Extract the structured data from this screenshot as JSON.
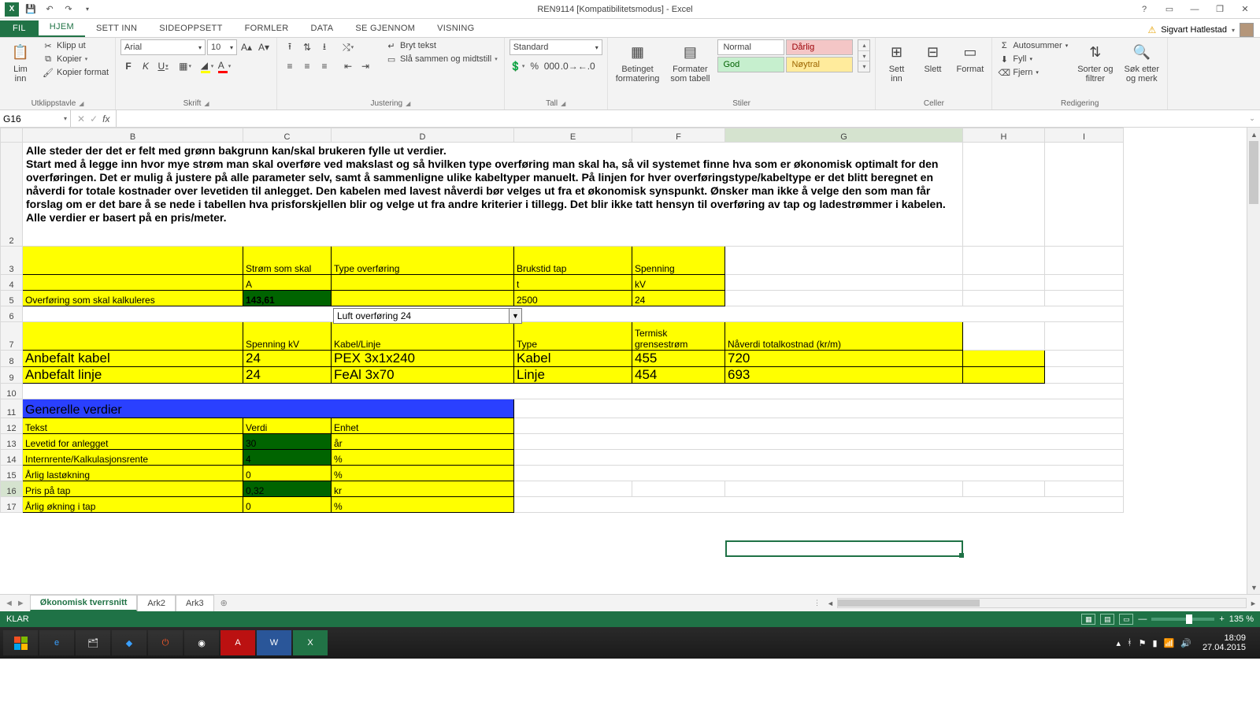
{
  "title": "REN9114  [Kompatibilitetsmodus] - Excel",
  "user_name": "Sigvart Hatlestad",
  "name_box": "G16",
  "formula_bar": "",
  "ribbon": {
    "tabs": {
      "file": "FIL",
      "home": "HJEM",
      "insert": "SETT INN",
      "layout": "SIDEOPPSETT",
      "formulas": "FORMLER",
      "data": "DATA",
      "review": "SE GJENNOM",
      "view": "VISNING"
    },
    "clipboard": {
      "paste": "Lim\ninn",
      "cut": "Klipp ut",
      "copy": "Kopier",
      "painter": "Kopier format",
      "label": "Utklippstavle"
    },
    "font": {
      "name": "Arial",
      "size": "10",
      "label": "Skrift",
      "bold": "F",
      "italic": "K",
      "underline": "U"
    },
    "alignment": {
      "wrap": "Bryt tekst",
      "merge": "Slå sammen og midtstill",
      "label": "Justering"
    },
    "number": {
      "format": "Standard",
      "label": "Tall"
    },
    "styles": {
      "cond": "Betinget\nformatering",
      "table": "Formater\nsom tabell",
      "normal": "Normal",
      "bad": "Dårlig",
      "good": "God",
      "neutral": "Nøytral",
      "label": "Stiler"
    },
    "cells": {
      "insert": "Sett\ninn",
      "delete": "Slett",
      "format": "Format",
      "label": "Celler"
    },
    "editing": {
      "autosum": "Autosummer",
      "fill": "Fyll",
      "clear": "Fjern",
      "sort": "Sorter og\nfiltrer",
      "find": "Søk etter\nog merk",
      "label": "Redigering"
    }
  },
  "col_heads": [
    "B",
    "C",
    "D",
    "E",
    "F",
    "G",
    "H",
    "I"
  ],
  "instr_text": "Alle steder der det er felt med grønn bakgrunn kan/skal brukeren fylle ut verdier.\nStart med å legge inn hvor mye strøm man skal overføre ved makslast og så hvilken type overføring man skal ha, så vil systemet finne hva som er økonomisk optimalt for den overføringen. Det er mulig å justere på alle parameter selv, samt å sammenligne ulike kabeltyper manuelt. På linjen for hver overføringstype/kabeltype er det blitt beregnet en nåverdi for totale kostnader over levetiden til anlegget. Den kabelen med lavest nåverdi bør velges ut fra et økonomisk synspunkt. Ønsker man ikke å velge den som man får forslag om er det bare å se nede i tabellen hva prisforskjellen blir og velge ut fra andre kriterier i tillegg. Det blir ikke tatt hensyn til overføring av tap og ladestrømmer i kabelen. Alle verdier er basert på en pris/meter.",
  "hdr1": {
    "c": "Strøm som skal",
    "d": "Type overføring",
    "e": "Brukstid tap",
    "f": "Spenning"
  },
  "units": {
    "c": "A",
    "e": "t",
    "f": "kV"
  },
  "input_row": {
    "b": "Overføring som skal kalkuleres",
    "c": "143,61",
    "d": "Luft overføring 24",
    "e": "2500",
    "f": "24"
  },
  "hdr2": {
    "c": "Spenning kV",
    "d": "Kabel/Linje",
    "e": "Type",
    "f": "Termisk grensestrøm",
    "g": "Nåverdi totalkostnad (kr/m)"
  },
  "rec_cable": {
    "b": "Anbefalt kabel",
    "c": "24",
    "d": "PEX 3x1x240",
    "e": "Kabel",
    "f": "455",
    "g": "720"
  },
  "rec_line": {
    "b": "Anbefalt linje",
    "c": "24",
    "d": "FeAl 3x70",
    "e": "Linje",
    "f": "454",
    "g": "693"
  },
  "gen_hdr": "Generelle verdier",
  "gen_cols": {
    "b": "Tekst",
    "c": "Verdi",
    "d": "Enhet"
  },
  "gen_rows": [
    {
      "b": "Levetid for anlegget",
      "c": "30",
      "d": "år"
    },
    {
      "b": "Internrente/Kalkulasjonsrente",
      "c": "4",
      "d": "%"
    },
    {
      "b": "Årlig lastøkning",
      "c": "0",
      "d": "%"
    },
    {
      "b": "Pris på tap",
      "c": "0,32",
      "d": "kr"
    },
    {
      "b": "Årlig økning i tap",
      "c": "0",
      "d": "%"
    }
  ],
  "sheet_tabs": {
    "t1": "Økonomisk tverrsnitt",
    "t2": "Ark2",
    "t3": "Ark3"
  },
  "status": {
    "ready": "KLAR",
    "zoom": "135 %"
  },
  "taskbar": {
    "time": "18:09",
    "date": "27.04.2015"
  },
  "chart_data": {
    "type": "table",
    "title": "Økonomisk tverrsnitt – inndata og anbefalinger",
    "inputs": {
      "strom_A": 143.61,
      "type_overforing": "Luft overføring 24",
      "brukstid_tap_t": 2500,
      "spenning_kV": 24
    },
    "anbefalinger": [
      {
        "navn": "Anbefalt kabel",
        "spenning_kV": 24,
        "kabel_linje": "PEX 3x1x240",
        "type": "Kabel",
        "termisk_grensestrom_A": 455,
        "naverdi_kr_per_m": 720
      },
      {
        "navn": "Anbefalt linje",
        "spenning_kV": 24,
        "kabel_linje": "FeAl 3x70",
        "type": "Linje",
        "termisk_grensestrom_A": 454,
        "naverdi_kr_per_m": 693
      }
    ],
    "generelle_verdier": [
      {
        "tekst": "Levetid for anlegget",
        "verdi": 30,
        "enhet": "år"
      },
      {
        "tekst": "Internrente/Kalkulasjonsrente",
        "verdi": 4,
        "enhet": "%"
      },
      {
        "tekst": "Årlig lastøkning",
        "verdi": 0,
        "enhet": "%"
      },
      {
        "tekst": "Pris på tap",
        "verdi": 0.32,
        "enhet": "kr"
      },
      {
        "tekst": "Årlig økning i tap",
        "verdi": 0,
        "enhet": "%"
      }
    ]
  }
}
